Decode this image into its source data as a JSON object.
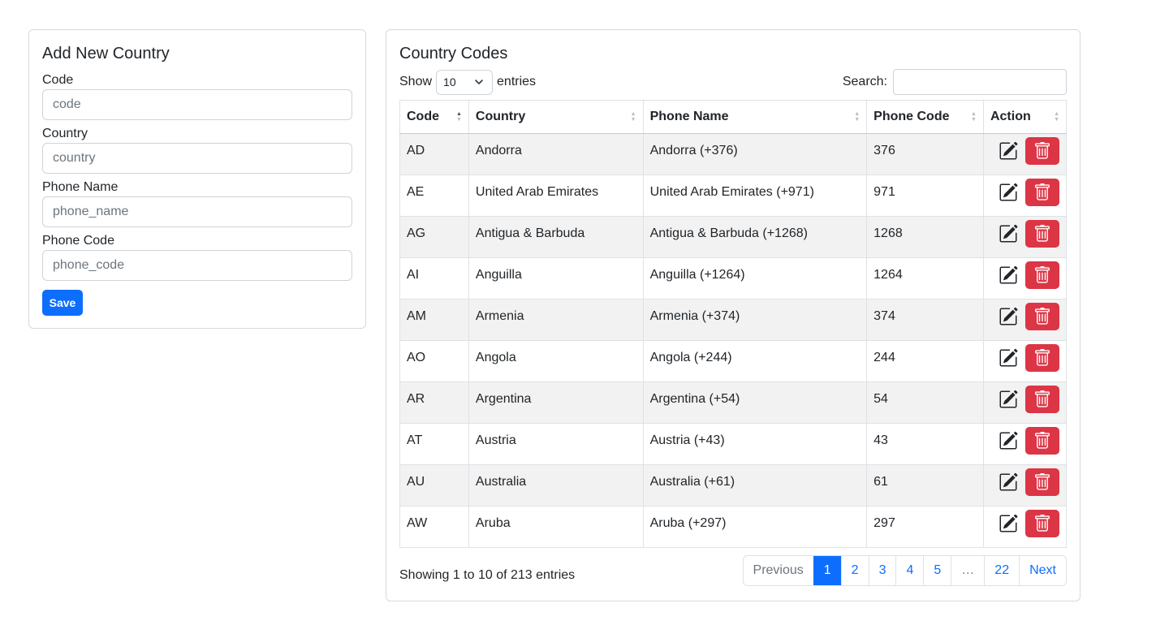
{
  "form": {
    "title": "Add New Country",
    "fields": [
      {
        "label": "Code",
        "placeholder": "code",
        "value": ""
      },
      {
        "label": "Country",
        "placeholder": "country",
        "value": ""
      },
      {
        "label": "Phone Name",
        "placeholder": "phone_name",
        "value": ""
      },
      {
        "label": "Phone Code",
        "placeholder": "phone_code",
        "value": ""
      }
    ],
    "save_label": "Save"
  },
  "table": {
    "title": "Country Codes",
    "show_label": "Show",
    "entries_label": "entries",
    "page_length": "10",
    "search_label": "Search:",
    "search_value": "",
    "columns": [
      "Code",
      "Country",
      "Phone Name",
      "Phone Code",
      "Action"
    ],
    "sorted_column": "Code",
    "sort_direction": "ascending",
    "rows": [
      {
        "code": "AD",
        "country": "Andorra",
        "phone_name": "Andorra (+376)",
        "phone_code": "376"
      },
      {
        "code": "AE",
        "country": "United Arab Emirates",
        "phone_name": "United Arab Emirates (+971)",
        "phone_code": "971"
      },
      {
        "code": "AG",
        "country": "Antigua & Barbuda",
        "phone_name": "Antigua & Barbuda (+1268)",
        "phone_code": "1268"
      },
      {
        "code": "AI",
        "country": "Anguilla",
        "phone_name": "Anguilla (+1264)",
        "phone_code": "1264"
      },
      {
        "code": "AM",
        "country": "Armenia",
        "phone_name": "Armenia (+374)",
        "phone_code": "374"
      },
      {
        "code": "AO",
        "country": "Angola",
        "phone_name": "Angola (+244)",
        "phone_code": "244"
      },
      {
        "code": "AR",
        "country": "Argentina",
        "phone_name": "Argentina (+54)",
        "phone_code": "54"
      },
      {
        "code": "AT",
        "country": "Austria",
        "phone_name": "Austria (+43)",
        "phone_code": "43"
      },
      {
        "code": "AU",
        "country": "Australia",
        "phone_name": "Australia (+61)",
        "phone_code": "61"
      },
      {
        "code": "AW",
        "country": "Aruba",
        "phone_name": "Aruba (+297)",
        "phone_code": "297"
      }
    ],
    "row_actions": {
      "edit_icon": "pencil-square-icon",
      "delete_icon": "trash-icon"
    },
    "info": "Showing 1 to 10 of 213 entries",
    "pagination": {
      "previous": "Previous",
      "pages": [
        "1",
        "2",
        "3",
        "4",
        "5",
        "…",
        "22"
      ],
      "active_page": "1",
      "next": "Next"
    }
  },
  "colors": {
    "primary": "#0d6efd",
    "danger": "#dc3545",
    "border": "#dee2e6",
    "striped_row": "#f2f2f2"
  }
}
